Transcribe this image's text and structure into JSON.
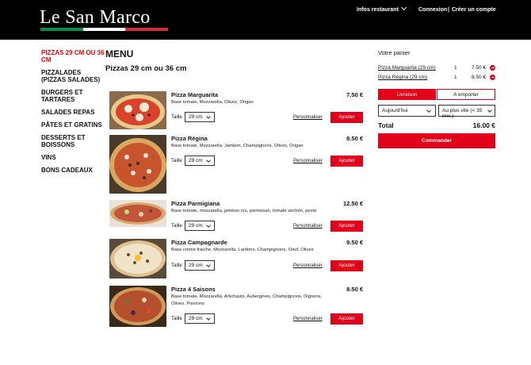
{
  "header": {
    "logo": "Le San Marco",
    "logo_colors": [
      "#009246",
      "#ffffff",
      "#ce2b37"
    ],
    "nav_infos": "Infos restaurant",
    "nav_login": "Connexion",
    "nav_sep": "|",
    "nav_account": "Créer un compte"
  },
  "sidebar": {
    "categories": [
      "PIZZAS 29 cm ou 36 cm",
      "Pizzalades (pizzas salades)",
      "Burgers et tartares",
      "Salades repas",
      "Pâtes et gratins",
      "Desserts et boissons",
      "Vins",
      "Bons cadeaux"
    ]
  },
  "menu": {
    "title": "MENU",
    "section": "Pizzas 29 cm ou 36 cm",
    "size_label": "Taille",
    "customize_label": "Personnaliser",
    "add_label": "Ajouter",
    "items": [
      {
        "name": "Pizza Marguarita",
        "price": "7.50 €",
        "desc": "Base tomate, Mozzarella, Olives, Origan",
        "size": "29 cm"
      },
      {
        "name": "Pizza Régina",
        "price": "8.50 €",
        "desc": "Base tomate, Mozzarella, Jambon, Champignons, Olives, Origan",
        "size": "29 cm"
      },
      {
        "name": "Pizza Parmigiana",
        "price": "12.50 €",
        "desc": "Base tomate, mozzarella, jambon cru, parmesan, tomate séchée, pesto",
        "size": "29 cm"
      },
      {
        "name": "Pizza Campagnarde",
        "price": "9.50 €",
        "desc": "Base crème fraiche, Mozzarella, Lardons, Champignons, Oeuf, Olives",
        "size": "29 cm"
      },
      {
        "name": "Pizza 4 Saisons",
        "price": "8.50 €",
        "desc": "Base tomate, Mozzarella, Artichauts, Aubergines, Champignons, Oignons, Olives, Poivrons",
        "size": "29 cm"
      }
    ]
  },
  "cart": {
    "title": "Votre panier",
    "rows": [
      {
        "name": "Pizza Marguarita (29 cm)",
        "qty": "1",
        "price": "7.50 €"
      },
      {
        "name": "Pizza Régina (29 cm)",
        "qty": "1",
        "price": "8.50 €"
      }
    ],
    "mode_delivery": "Livraison",
    "mode_takeaway": "A emporter",
    "day": "Aujourd'hui",
    "time": "Au plus vite (< 35 min.)",
    "total_label": "Total",
    "total_value": "16.00 €",
    "order_label": "Commander"
  },
  "colors": {
    "accent": "#e2001a",
    "topbar": "#000000"
  }
}
